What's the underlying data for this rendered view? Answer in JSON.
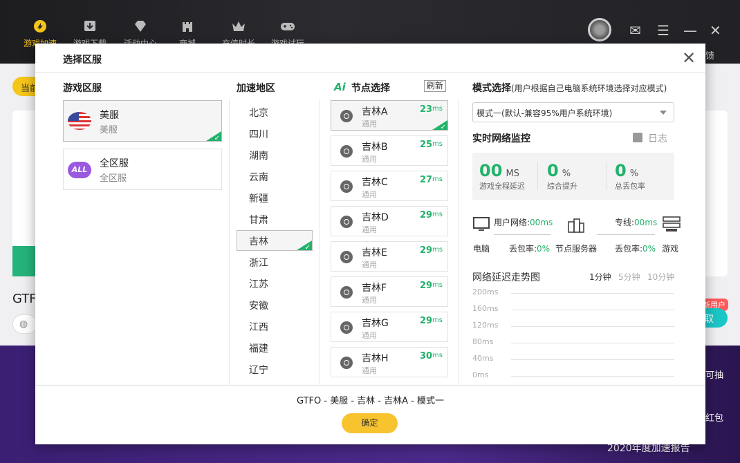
{
  "app": {
    "nav": [
      {
        "label": "游戏加速"
      },
      {
        "label": "游戏下载"
      },
      {
        "label": "活动中心"
      },
      {
        "label": "商城"
      },
      {
        "label": "充值时长"
      },
      {
        "label": "游戏试玩"
      }
    ],
    "bg_current": "当前",
    "bg_game": "GTF",
    "bg_new_user": "新用户",
    "bg_collect": "取",
    "bg_feedback": "馈",
    "bg_side1": "可抽",
    "bg_side2": "红包",
    "bg_report": "2020年度加速报告"
  },
  "dialog": {
    "title": "选择区服",
    "columns": {
      "server": "游戏区服",
      "region": "加速地区",
      "node": "节点选择",
      "mode": "模式选择",
      "mode_sub": "(用户根据自己电脑系统环境选择对应模式)"
    },
    "ai_logo": "Ai",
    "refresh": "刷新",
    "servers": [
      {
        "name": "美服",
        "sub": "美服",
        "selected": true
      },
      {
        "name": "全区服",
        "sub": "全区服",
        "badge": "ALL",
        "selected": false
      }
    ],
    "regions": [
      "北京",
      "四川",
      "湖南",
      "云南",
      "新疆",
      "甘肃",
      "吉林",
      "浙江",
      "江苏",
      "安徽",
      "江西",
      "福建",
      "辽宁"
    ],
    "selected_region": "吉林",
    "nodes": [
      {
        "name": "吉林A",
        "type": "通用",
        "ping": "23",
        "unit": "ms",
        "selected": true
      },
      {
        "name": "吉林B",
        "type": "通用",
        "ping": "25",
        "unit": "ms"
      },
      {
        "name": "吉林C",
        "type": "通用",
        "ping": "27",
        "unit": "ms"
      },
      {
        "name": "吉林D",
        "type": "通用",
        "ping": "29",
        "unit": "ms"
      },
      {
        "name": "吉林E",
        "type": "通用",
        "ping": "29",
        "unit": "ms"
      },
      {
        "name": "吉林F",
        "type": "通用",
        "ping": "29",
        "unit": "ms"
      },
      {
        "name": "吉林G",
        "type": "通用",
        "ping": "29",
        "unit": "ms"
      },
      {
        "name": "吉林H",
        "type": "通用",
        "ping": "30",
        "unit": "ms"
      }
    ],
    "mode_select": "模式一(默认-兼容95%用户系统环境)",
    "monitor": {
      "title": "实时网络监控",
      "log": "日志",
      "stats": [
        {
          "value": "00",
          "unit": "MS",
          "label": "游戏全程延迟"
        },
        {
          "value": "0",
          "unit": "%",
          "label": "综合提升"
        },
        {
          "value": "0",
          "unit": "%",
          "label": "总丢包率"
        }
      ],
      "user_net_label": "用户网络:",
      "user_net_value": "00ms",
      "line_label": "专线:",
      "line_value": "00ms",
      "pc": "电脑",
      "loss_label1": "丢包率:",
      "loss_value1": "0%",
      "node_server": "节点服务器",
      "loss_label2": "丢包率:",
      "loss_value2": "0%",
      "game": "游戏"
    },
    "trend": {
      "title": "网络延迟走势图",
      "tabs": [
        "1分钟",
        "5分钟",
        "10分钟"
      ],
      "active_tab": 0,
      "yticks": [
        "200ms",
        "160ms",
        "120ms",
        "80ms",
        "40ms",
        "0ms"
      ]
    },
    "summary": "GTFO - 美服 - 吉林 - 吉林A - 模式一",
    "confirm": "确定"
  },
  "colors": {
    "accent_green": "#22b26a",
    "confirm_yellow": "#f7c32e",
    "active_nav": "#f5c518"
  }
}
